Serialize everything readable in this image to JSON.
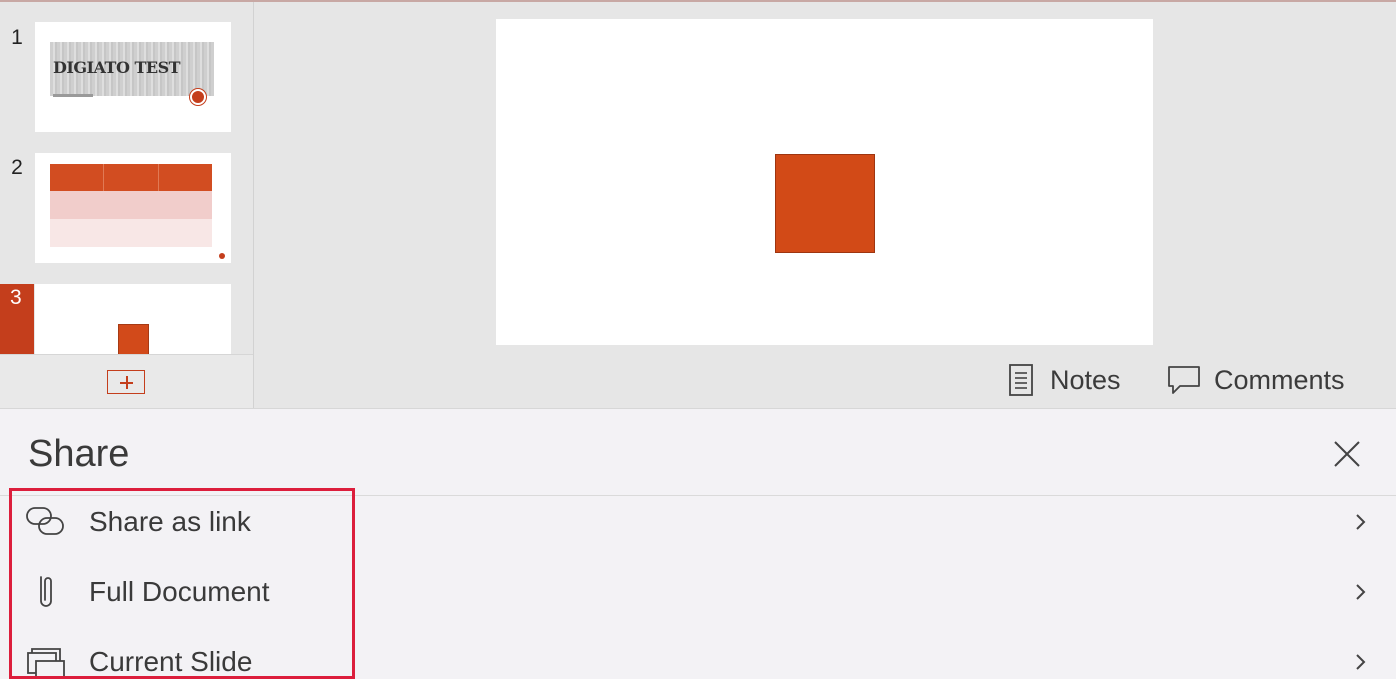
{
  "slides_panel": {
    "thumbnails": [
      {
        "number": "1",
        "title_text": "DIGIATO TEST"
      },
      {
        "number": "2"
      },
      {
        "number": "3",
        "selected": true
      }
    ]
  },
  "toolbar": {
    "notes_label": "Notes",
    "comments_label": "Comments"
  },
  "share_sheet": {
    "title": "Share",
    "options": [
      {
        "label": "Share as link",
        "icon": "link-icon"
      },
      {
        "label": "Full Document",
        "icon": "paperclip-icon"
      },
      {
        "label": "Current Slide",
        "icon": "slides-icon"
      }
    ]
  },
  "colors": {
    "accent": "#c43e1c",
    "shape_fill": "#d24a17",
    "highlight_border": "#dc1e3c",
    "sheet_background": "#f3f2f5"
  }
}
